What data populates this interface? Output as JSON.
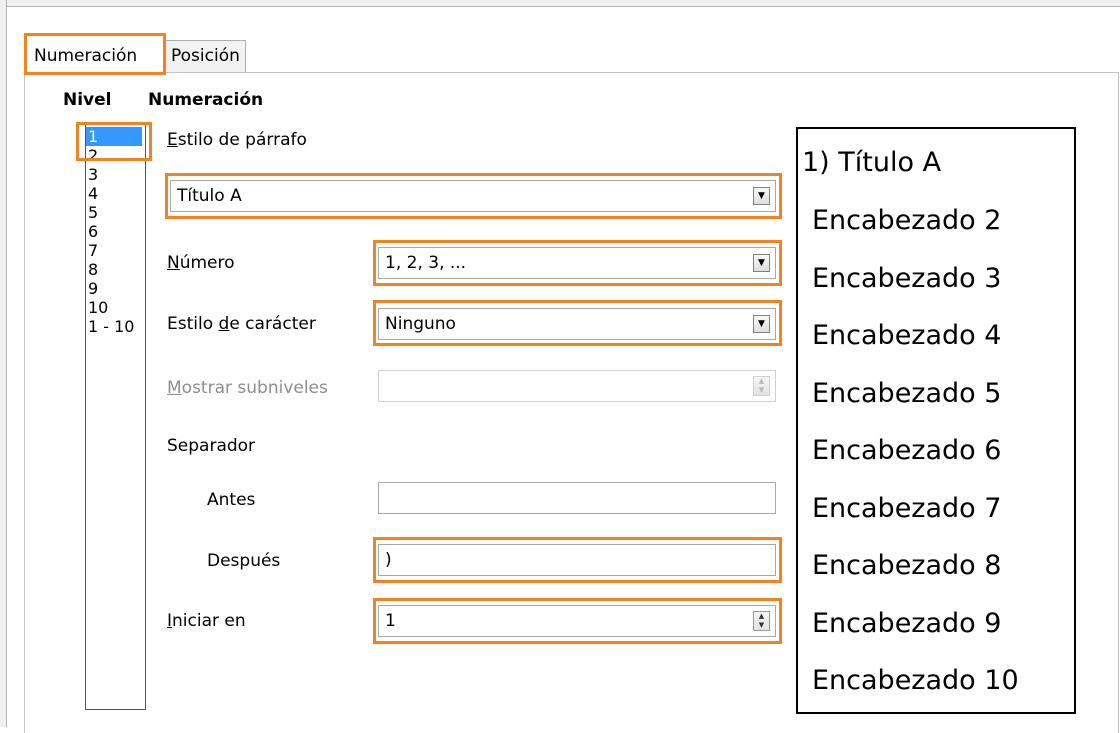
{
  "tabs": [
    {
      "label": "Numeración",
      "active": true
    },
    {
      "label": "Posición",
      "active": false
    }
  ],
  "headers": {
    "level": "Nivel",
    "numbering": "Numeración"
  },
  "levels": [
    "1",
    "2",
    "3",
    "4",
    "5",
    "6",
    "7",
    "8",
    "9",
    "10",
    "1 - 10"
  ],
  "selected_level": "1",
  "form": {
    "paragraph_style": {
      "label": "Estilo de párrafo",
      "value": "Título A"
    },
    "number": {
      "label": "Número",
      "value": "1, 2, 3, ..."
    },
    "char_style": {
      "label_pre": "Estilo ",
      "label_u": "d",
      "label_post": "e carácter",
      "value": "Ninguno"
    },
    "sublevels": {
      "label": "Mostrar subniveles",
      "value": ""
    },
    "separator": {
      "label": "Separador"
    },
    "before": {
      "label": "Antes",
      "value": ""
    },
    "after": {
      "label": "Después",
      "value": ")"
    },
    "start_at": {
      "label": "Iniciar en",
      "value": "1"
    }
  },
  "preview": [
    "1) Título A",
    "Encabezado 2",
    "Encabezado 3",
    "Encabezado 4",
    "Encabezado 5",
    "Encabezado 6",
    "Encabezado 7",
    "Encabezado 8",
    "Encabezado 9",
    "Encabezado 10"
  ],
  "colors": {
    "highlight": "#f58220",
    "selection": "#3399ff"
  },
  "icons": {
    "dropdown": "triangle-down",
    "spinner": "up-down-arrows"
  }
}
